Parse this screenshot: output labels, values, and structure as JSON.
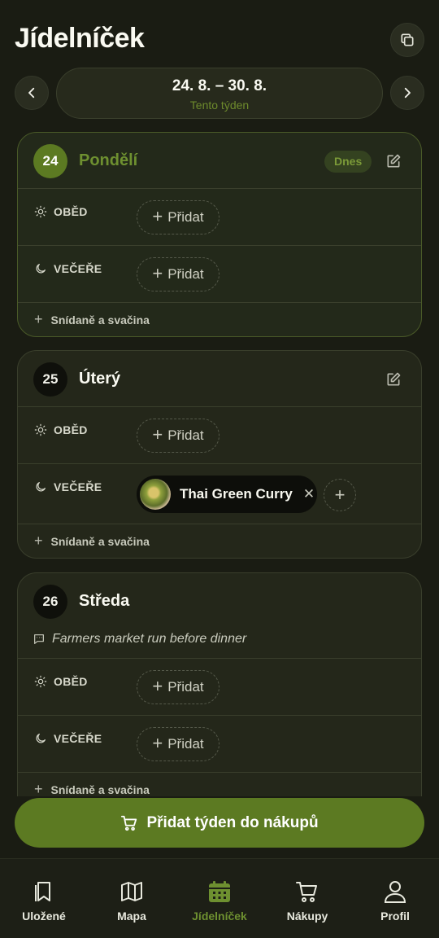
{
  "header": {
    "title": "Jídelníček"
  },
  "week": {
    "range": "24. 8. – 30. 8.",
    "subtitle": "Tento týden"
  },
  "labels": {
    "lunch": "OBĚD",
    "dinner": "VEČEŘE",
    "add": "Přidat",
    "snacks": "Snídaně a svačina"
  },
  "days": [
    {
      "num": "24",
      "name": "Pondělí",
      "badge": "Dnes"
    },
    {
      "num": "25",
      "name": "Úterý",
      "dinner_item": "Thai Green Curry"
    },
    {
      "num": "26",
      "name": "Středa",
      "note": "Farmers market run before dinner"
    }
  ],
  "cta": {
    "label": "Přidat týden do nákupů"
  },
  "tabs": [
    {
      "label": "Uložené"
    },
    {
      "label": "Mapa"
    },
    {
      "label": "Jídelníček"
    },
    {
      "label": "Nákupy"
    },
    {
      "label": "Profil"
    }
  ],
  "colors": {
    "accent": "#5c7a22",
    "accent_text": "#6e9030",
    "background": "#1a1c13"
  },
  "active_tab": "Jídelníček"
}
